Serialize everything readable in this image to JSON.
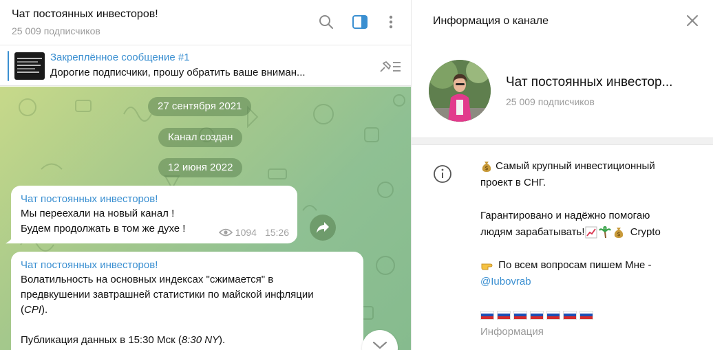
{
  "chat": {
    "title": "Чат постоянных инвесторов!",
    "subscribers": "25 009 подписчиков"
  },
  "pinned": {
    "title": "Закреплённое сообщение #1",
    "text": "Дорогие подписчики, прошу обратить ваше вниман..."
  },
  "dates": {
    "first": "27 сентября 2021",
    "created": "Канал создан",
    "second": "12 июня 2022"
  },
  "messages": [
    {
      "sender": "Чат постоянных инвесторов!",
      "line1": "Мы переехали на новый канал !",
      "line2": "Будем продолжать в том же духе !",
      "views": "1094",
      "time": "15:26"
    },
    {
      "sender": "Чат постоянных инвесторов!",
      "line1": "Волатильность на основных индексах \"сжимается\" в",
      "line2": "предвкушении завтрашней статистики по майской инфляции",
      "line3_pre": "(",
      "line3_em": "CPI",
      "line3_post": ").",
      "line5_pre": "Публикация данных в 15:30 Мск (",
      "line5_em": "8:30 NY",
      "line5_post": ")."
    }
  ],
  "info": {
    "header": "Информация о канале",
    "name": "Чат постоянных инвестор...",
    "subscribers": "25 009 подписчиков",
    "desc_line1": "Самый крупный инвестиционный",
    "desc_line2": "проект в СНГ.",
    "desc_line3": "Гарантировано и надёжно помогаю",
    "desc_line4": "людям зарабатывать!",
    "desc_line4_tail": "Crypto",
    "desc_line5": "По всем вопросам пишем Мне -",
    "link": "@Iubovrab",
    "label": "Информация"
  },
  "colors": {
    "accent": "#3a8fd1",
    "chat_bg": "#a7c98b"
  },
  "icons": [
    "search-icon",
    "sidebar-toggle-icon",
    "more-icon",
    "unpin-icon",
    "views-icon",
    "forward-icon",
    "chevron-down-icon",
    "close-icon",
    "info-icon",
    "money-bag-emoji",
    "chart-emoji",
    "palm-emoji",
    "pointing-hand-emoji",
    "russia-flag-emoji"
  ]
}
